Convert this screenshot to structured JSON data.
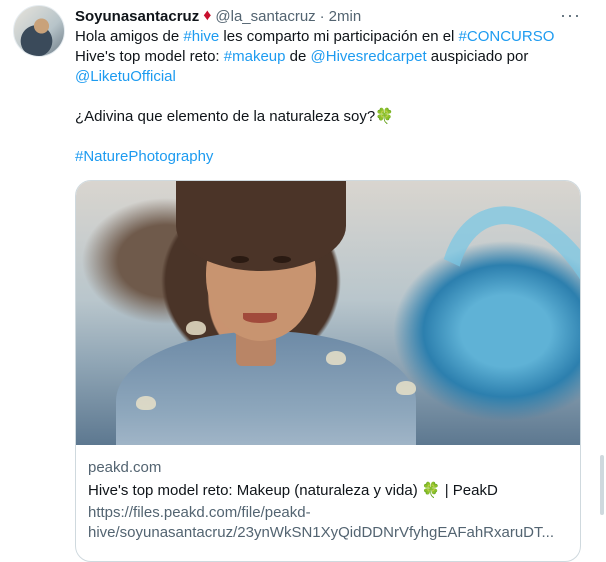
{
  "tweet": {
    "display_name": "Soyunasantacruz",
    "handle": "@la_santacruz",
    "separator": "·",
    "time": "2min",
    "more_glyph": "···",
    "badge_glyph": "♦",
    "line1": {
      "t1": "Hola amigos de ",
      "hashtag_hive": "#hive",
      "t2": " les comparto mi participación en el ",
      "hashtag_concurso": "#CONCURSO"
    },
    "line2": {
      "t1": "Hive's top model reto: ",
      "hashtag_makeup": "#makeup",
      "t2": " de ",
      "mention_hivesredcarpet": "@Hivesredcarpet",
      "t3": " auspiciado por"
    },
    "line3": {
      "mention_liketuofficial": "@LiketuOfficial"
    },
    "question": "¿Adivina que elemento de la naturaleza soy?",
    "clover_glyph": "🍀",
    "hashtag_naturephotography": "#NaturePhotography"
  },
  "card": {
    "domain": "peakd.com",
    "title_t1": "Hive's top model reto: Makeup (naturaleza y vida) ",
    "title_clover": "🍀",
    "title_t2": " | PeakD",
    "url_line1": "https://files.peakd.com/file/peakd-",
    "url_line2": "hive/soyunasantacruz/23ynWkSN1XyQidDDNrVfyhgEAFahRxaruDT..."
  }
}
